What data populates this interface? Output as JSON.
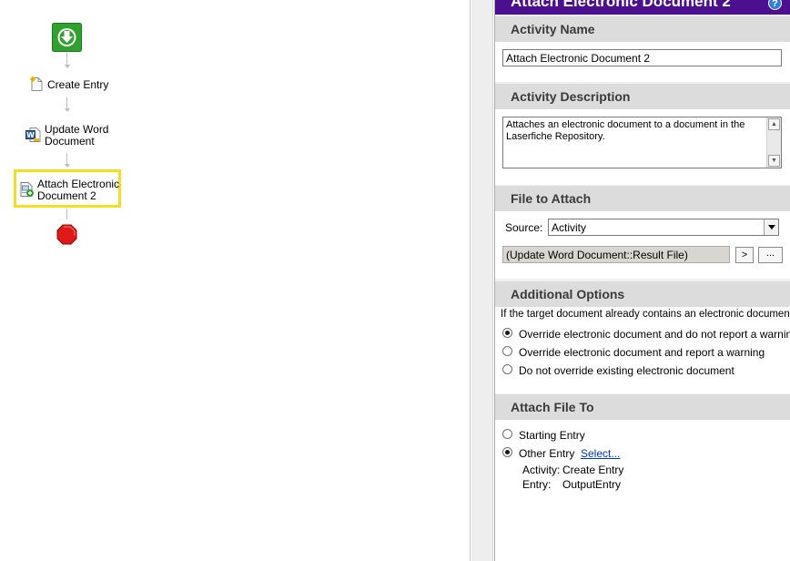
{
  "workflow": {
    "nodes": {
      "create_entry": "Create Entry",
      "update_word_line1": "Update Word",
      "update_word_line2": "Document",
      "attach_line1": "Attach Electronic",
      "attach_line2": "Document 2"
    },
    "icons": {
      "start": "start-arrow-icon",
      "create": "new-document-icon",
      "word": "word-document-icon",
      "attach": "attach-document-icon",
      "stop": "stop-sign-icon"
    },
    "colors": {
      "selection": "#f0e020",
      "start": "#2ea12e",
      "stop": "#e01818"
    }
  },
  "panel": {
    "title": "Attach Electronic Document 2",
    "title_bg": "#4b0f8f",
    "help_label": "?",
    "activity_name": {
      "header": "Activity Name",
      "value": "Attach Electronic Document 2"
    },
    "activity_description": {
      "header": "Activity Description",
      "value": "Attaches an electronic document to a document in the Laserfiche Repository."
    },
    "file_to_attach": {
      "header": "File to Attach",
      "source_label": "Source:",
      "source_value": "Activity",
      "result_value": "(Update Word Document::Result File)",
      "token_button": ">",
      "browse_button": "..."
    },
    "additional_options": {
      "header": "Additional Options",
      "prompt": "If the target document already contains an electronic document:",
      "options": [
        "Override electronic document and do not report a warning",
        "Override electronic document and report a warning",
        "Do not override existing electronic document"
      ],
      "selected_index": 0
    },
    "attach_file_to": {
      "header": "Attach File To",
      "starting_entry": "Starting Entry",
      "other_entry": "Other Entry",
      "select_link": "Select...",
      "activity_label": "Activity:",
      "activity_value": "Create Entry",
      "entry_label": "Entry:",
      "entry_value": "OutputEntry",
      "selected": "other_entry"
    }
  }
}
